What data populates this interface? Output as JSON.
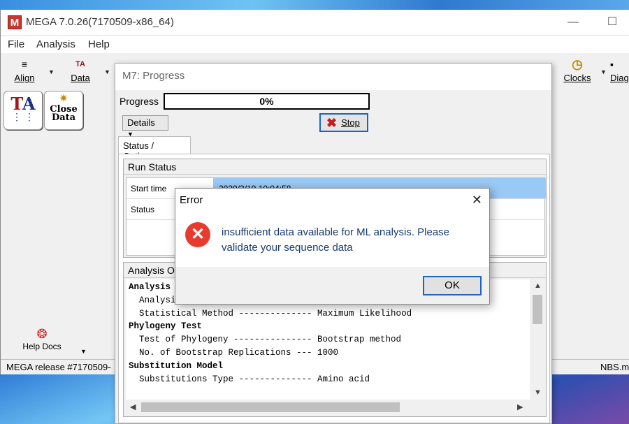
{
  "main_window": {
    "title": "MEGA 7.0.26(7170509-x86_64)",
    "app_icon_letter": "M",
    "menus": [
      "File",
      "Analysis",
      "Help"
    ],
    "toolbar": {
      "align_label": "Align",
      "data_label": "Data",
      "clocks_label": "Clocks",
      "diag_label": "Diag"
    },
    "launch_buttons": {
      "ta_glyph": "TA",
      "close_data_label_1": "Close",
      "close_data_label_2": "Data"
    },
    "help_docs_label": "Help Docs",
    "status_left": "MEGA release #7170509-",
    "status_right": "NBS.me"
  },
  "progress_window": {
    "title": "M7: Progress",
    "progress_label": "Progress",
    "progress_percent": "0%",
    "progress_value": 0,
    "details_button": "Details",
    "stop_button": "Stop",
    "tab_label": "Status / Options",
    "run_status": {
      "heading": "Run Status",
      "rows": [
        {
          "key": "Start time",
          "value": "2020/3/19 10:04:58"
        },
        {
          "key": "Status",
          "value": ""
        }
      ]
    },
    "analysis_options": {
      "heading": "Analysis Op",
      "lines": [
        {
          "text": "Analysis",
          "bold": true
        },
        {
          "text": "  Analysis",
          "bold": false
        },
        {
          "text": "  Statistical Method -------------- Maximum Likelihood",
          "bold": false
        },
        {
          "text": "Phylogeny Test",
          "bold": true
        },
        {
          "text": "  Test of Phylogeny --------------- Bootstrap method",
          "bold": false
        },
        {
          "text": "  No. of Bootstrap Replications --- 1000",
          "bold": false
        },
        {
          "text": "Substitution Model",
          "bold": true
        },
        {
          "text": "  Substitutions Type -------------- Amino acid",
          "bold": false
        }
      ]
    }
  },
  "error_dialog": {
    "title": "Error",
    "message": "insufficient data available for ML analysis. Please validate your sequence data",
    "ok_button": "OK"
  },
  "colors": {
    "error_red": "#e63b2e",
    "accent_blue": "#1b63c6",
    "selection_blue": "#99c9f5"
  }
}
